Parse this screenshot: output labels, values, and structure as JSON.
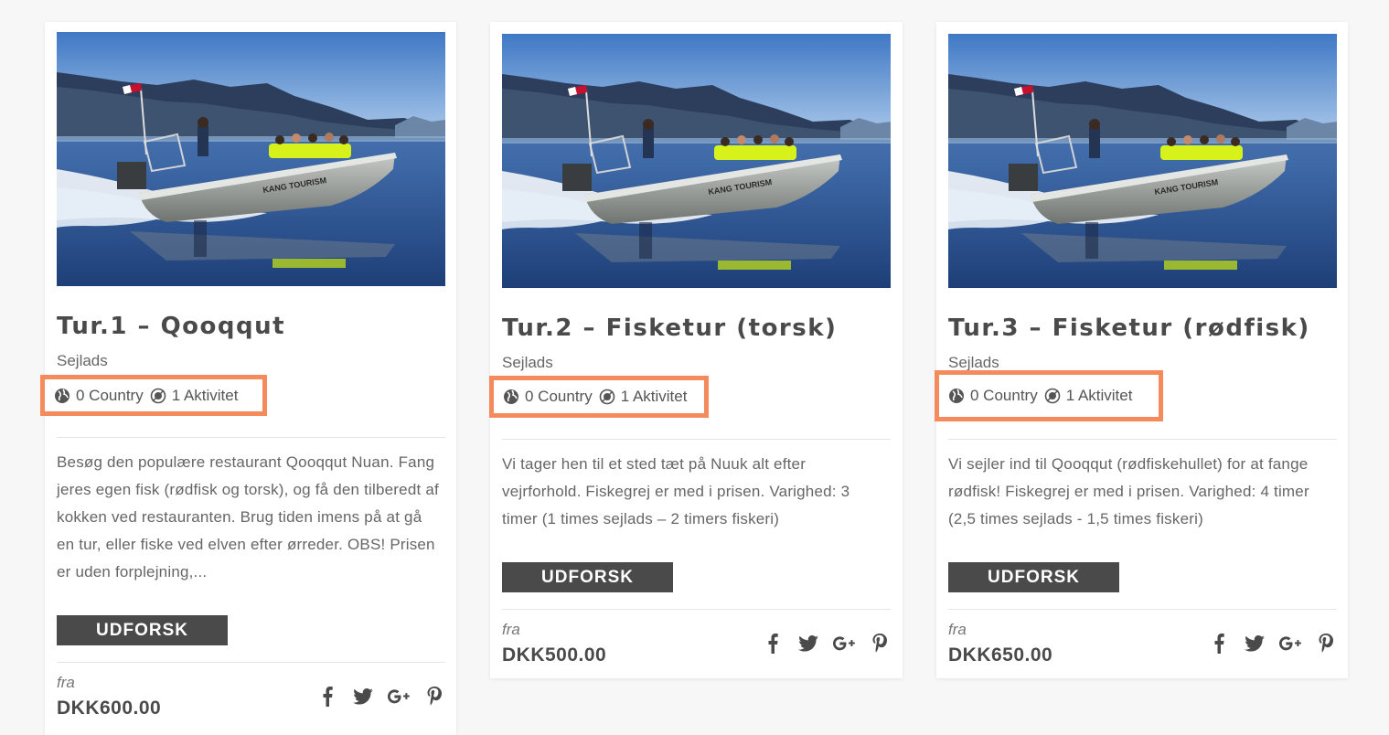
{
  "cards": [
    {
      "title": "Tur.1 – Qooqqut",
      "category": "Sejlads",
      "country": "0 Country",
      "activity": "1 Aktivitet",
      "description": "Besøg den populære restaurant Qooqqut Nuan. Fang jeres egen fisk (rødfisk og torsk), og få den tilberedt af kokken ved restauranten. Brug tiden imens på at gå en tur, eller fiske ved elven efter ørreder. OBS! Prisen er uden forplejning,...",
      "button": "UDFORSK",
      "from": "fra",
      "price": "DKK600.00"
    },
    {
      "title": "Tur.2 – Fisketur (torsk)",
      "category": "Sejlads",
      "country": "0 Country",
      "activity": "1 Aktivitet",
      "description": "Vi tager hen til et sted tæt på Nuuk alt efter vejrforhold. Fiskegrej er med i prisen. Varighed: 3 timer (1 times sejlads – 2 timers fiskeri)",
      "button": "UDFORSK",
      "from": "fra",
      "price": "DKK500.00"
    },
    {
      "title": "Tur.3 – Fisketur (rødfisk)",
      "category": "Sejlads",
      "country": "0 Country",
      "activity": "1 Aktivitet",
      "description": "Vi sejler ind til Qooqqut (rødfiskehullet) for at fange rødfisk! Fiskegrej er med i prisen. Varighed: 4 timer (2,5 times sejlads - 1,5 times fiskeri)",
      "button": "UDFORSK",
      "from": "fra",
      "price": "DKK650.00"
    }
  ],
  "boat_text": "KANG TOURISM",
  "icons": {
    "country": "globe-icon",
    "activity": "activity-icon",
    "social": [
      "facebook-icon",
      "twitter-icon",
      "google-plus-icon",
      "pinterest-icon"
    ]
  },
  "colors": {
    "highlight_border": "#f58a5c",
    "button_bg": "#4a4a4a",
    "text_dark": "#4a4a4a"
  }
}
